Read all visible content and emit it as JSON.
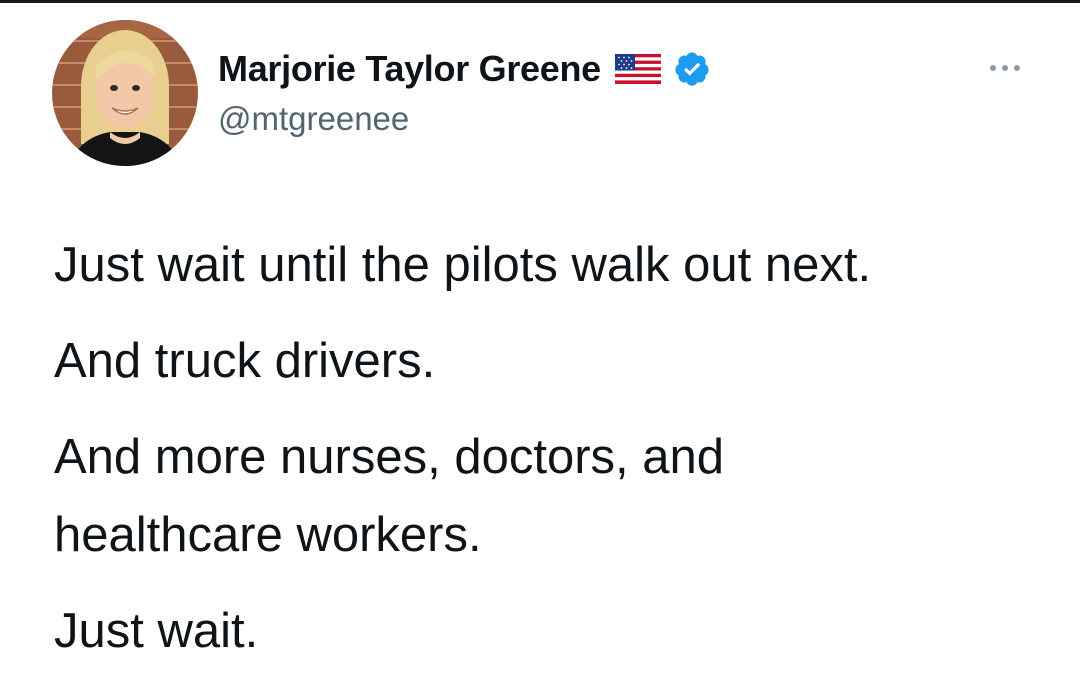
{
  "author": {
    "display_name": "Marjorie Taylor Greene",
    "handle": "@mtgreenee",
    "avatar_icon": "profile-photo",
    "flag_icon": "us-flag-icon",
    "verified_icon": "verified-badge-icon",
    "verified_color": "#1d9bf0"
  },
  "actions": {
    "more_icon": "more-options-icon"
  },
  "tweet": {
    "paragraphs": [
      {
        "lines": [
          "Just wait until the pilots walk out next."
        ]
      },
      {
        "lines": [
          "And truck drivers."
        ]
      },
      {
        "lines": [
          "And more nurses, doctors, and",
          "healthcare workers."
        ]
      },
      {
        "lines": [
          "Just wait."
        ]
      }
    ]
  },
  "colors": {
    "text": "#0f1419",
    "secondary_text": "#536471",
    "background": "#ffffff"
  }
}
